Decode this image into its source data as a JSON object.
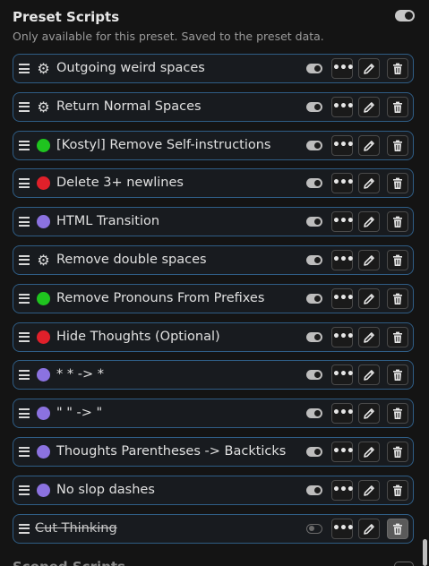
{
  "header": {
    "title": "Preset Scripts",
    "subtitle": "Only available for this preset. Saved to the preset data.",
    "enabled": true
  },
  "status_colors": {
    "green": "#1fc41f",
    "red": "#e0202a",
    "purple": "#8b72e0"
  },
  "scripts": [
    {
      "label": "Outgoing weird spaces",
      "status": "gear-icon",
      "enabled": true,
      "disabled_style": false
    },
    {
      "label": "Return Normal Spaces",
      "status": "gear-icon",
      "enabled": true,
      "disabled_style": false
    },
    {
      "label": "[Kostyl] Remove Self-instructions",
      "status": "green",
      "enabled": true,
      "disabled_style": false
    },
    {
      "label": "Delete 3+ newlines",
      "status": "red",
      "enabled": true,
      "disabled_style": false
    },
    {
      "label": "HTML Transition",
      "status": "purple",
      "enabled": true,
      "disabled_style": false
    },
    {
      "label": "Remove double spaces",
      "status": "gear-icon",
      "enabled": true,
      "disabled_style": false
    },
    {
      "label": "Remove Pronouns From Prefixes",
      "status": "green",
      "enabled": true,
      "disabled_style": false
    },
    {
      "label": "Hide Thoughts (Optional)",
      "status": "red",
      "enabled": true,
      "disabled_style": false
    },
    {
      "label": "* * -> *",
      "status": "purple",
      "enabled": true,
      "disabled_style": false
    },
    {
      "label": "\" \" -> \"",
      "status": "purple",
      "enabled": true,
      "disabled_style": false
    },
    {
      "label": "Thoughts Parentheses -> Backticks",
      "status": "purple",
      "enabled": true,
      "disabled_style": false
    },
    {
      "label": "No slop dashes",
      "status": "purple",
      "enabled": true,
      "disabled_style": false
    },
    {
      "label": "Cut Thinking",
      "status": "none",
      "enabled": false,
      "disabled_style": true
    }
  ],
  "next_section": {
    "title": "Scoped Scripts"
  },
  "buttons": {
    "more_label": "•••"
  }
}
